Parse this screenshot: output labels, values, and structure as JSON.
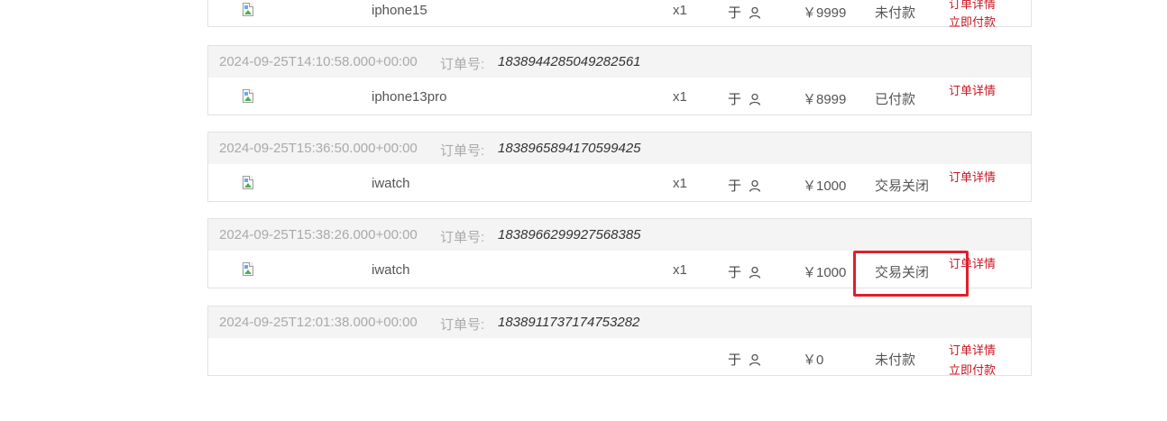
{
  "labels": {
    "order_no": "订单号:",
    "order_detail": "订单详情",
    "pay_now": "立即付款",
    "qty_prefix": "x"
  },
  "orders": [
    {
      "product": "iphone15",
      "qty": "x1",
      "person": "于",
      "price": "￥9999",
      "status": "未付款",
      "actions": [
        "订单详情",
        "立即付款"
      ]
    },
    {
      "time": "2024-09-25T14:10:58.000+00:00",
      "order_no": "1838944285049282561",
      "product": "iphone13pro",
      "qty": "x1",
      "person": "于",
      "price": "￥8999",
      "status": "已付款",
      "actions": [
        "订单详情"
      ]
    },
    {
      "time": "2024-09-25T15:36:50.000+00:00",
      "order_no": "1838965894170599425",
      "product": "iwatch",
      "qty": "x1",
      "person": "于",
      "price": "￥1000",
      "status": "交易关闭",
      "actions": [
        "订单详情"
      ]
    },
    {
      "time": "2024-09-25T15:38:26.000+00:00",
      "order_no": "1838966299927568385",
      "product": "iwatch",
      "qty": "x1",
      "person": "于",
      "price": "￥1000",
      "status": "交易关闭",
      "actions": [
        "订单详情"
      ]
    },
    {
      "time": "2024-09-25T12:01:38.000+00:00",
      "order_no": "1838911737174753282",
      "product": "",
      "qty": "",
      "person": "于",
      "price": "￥0",
      "status": "未付款",
      "actions": [
        "订单详情",
        "立即付款"
      ]
    }
  ],
  "colors": {
    "action": "#c81623",
    "header_bg": "#f4f4f4",
    "highlight": "#e0202a"
  },
  "icons": {
    "product_image": "broken-image-icon",
    "person": "user-icon"
  }
}
